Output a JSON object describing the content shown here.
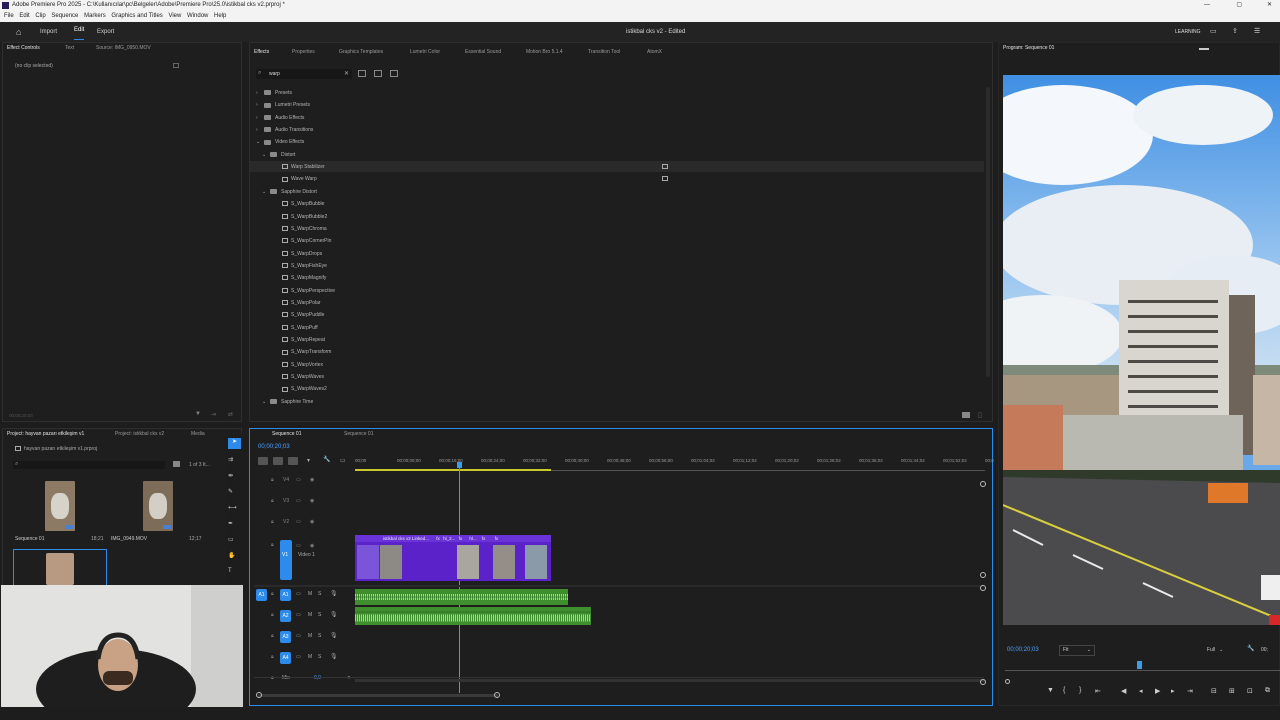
{
  "app": {
    "title": "Adobe Premiere Pro 2025 - C:\\Kullanıcılar\\pc\\Belgeler\\Adobe\\Premiere Pro\\25.0\\istikbal cks v2.prproj *",
    "menu": [
      "File",
      "Edit",
      "Clip",
      "Sequence",
      "Markers",
      "Graphics and Titles",
      "View",
      "Window",
      "Help"
    ],
    "workspaces": [
      "Import",
      "Edit",
      "Export"
    ],
    "project_title": "istikbal cks v2 - Edited",
    "learning": "LEARNING"
  },
  "source_panel": {
    "tabs": [
      "Effect Controls",
      "Text",
      "Source: IMG_0950.MOV"
    ],
    "no_clip": "(no clip selected)",
    "timecode": "00;00;20;03"
  },
  "effects_panel": {
    "tabs": [
      "Effects",
      "Properties",
      "Graphics Templates",
      "Lumetri Color",
      "Essential Sound",
      "Motion Bro 5.1.4",
      "Transition Tool",
      "AtomX"
    ],
    "search_value": "warp",
    "tree": [
      {
        "label": "Presets",
        "type": "folder",
        "level": 0,
        "open": false
      },
      {
        "label": "Lumetri Presets",
        "type": "folder",
        "level": 0,
        "open": false
      },
      {
        "label": "Audio Effects",
        "type": "folder",
        "level": 0,
        "open": false
      },
      {
        "label": "Audio Transitions",
        "type": "folder",
        "level": 0,
        "open": false
      },
      {
        "label": "Video Effects",
        "type": "folder",
        "level": 0,
        "open": true
      },
      {
        "label": "Distort",
        "type": "folder",
        "level": 1,
        "open": true
      },
      {
        "label": "Warp Stabilizer",
        "type": "effect",
        "level": 2,
        "selected": true,
        "accel": true
      },
      {
        "label": "Wave Warp",
        "type": "effect",
        "level": 2,
        "accel": true
      },
      {
        "label": "Sapphire Distort",
        "type": "folder",
        "level": 1,
        "open": true
      },
      {
        "label": "S_WarpBubble",
        "type": "effect",
        "level": 2
      },
      {
        "label": "S_WarpBubble2",
        "type": "effect",
        "level": 2
      },
      {
        "label": "S_WarpChroma",
        "type": "effect",
        "level": 2
      },
      {
        "label": "S_WarpCornerPin",
        "type": "effect",
        "level": 2
      },
      {
        "label": "S_WarpDrops",
        "type": "effect",
        "level": 2
      },
      {
        "label": "S_WarpFishEye",
        "type": "effect",
        "level": 2
      },
      {
        "label": "S_WarpMagnify",
        "type": "effect",
        "level": 2
      },
      {
        "label": "S_WarpPerspective",
        "type": "effect",
        "level": 2
      },
      {
        "label": "S_WarpPolar",
        "type": "effect",
        "level": 2
      },
      {
        "label": "S_WarpPuddle",
        "type": "effect",
        "level": 2
      },
      {
        "label": "S_WarpPuff",
        "type": "effect",
        "level": 2
      },
      {
        "label": "S_WarpRepeat",
        "type": "effect",
        "level": 2
      },
      {
        "label": "S_WarpTransform",
        "type": "effect",
        "level": 2
      },
      {
        "label": "S_WarpVortex",
        "type": "effect",
        "level": 2
      },
      {
        "label": "S_WarpWaves",
        "type": "effect",
        "level": 2
      },
      {
        "label": "S_WarpWaves2",
        "type": "effect",
        "level": 2
      },
      {
        "label": "Sapphire Time",
        "type": "folder",
        "level": 1,
        "open": true
      }
    ]
  },
  "program_monitor": {
    "tab": "Program: Sequence 01",
    "timecode": "00;00;20;03",
    "fit": "Fit",
    "quality": "Full",
    "end_timecode": "00;"
  },
  "project_panel": {
    "tabs": [
      "Project: hayvan pazarı etkileşim v1",
      "Project: istikbal cks v2",
      "Media"
    ],
    "path": "hayvan pazarı etkileşim v1.prproj",
    "count": "1 of 3 It...",
    "items": [
      {
        "name": "Sequence 01",
        "duration": "18;21"
      },
      {
        "name": "IMG_0949.MOV",
        "duration": "12;17"
      }
    ]
  },
  "timeline": {
    "tabs": [
      "Sequence 01",
      "Sequence 01"
    ],
    "timecode": "00;00;20;03",
    "ruler": [
      "00;00",
      "00;00;08;00",
      "00;00;16;00",
      "00;00;24;00",
      "00;00;32;00",
      "00;00;40;00",
      "00;00;48;00",
      "00;00;56;00",
      "00;01;04;02",
      "00;01;12;02",
      "00;01;20;02",
      "00;01;28;02",
      "00;01;36;02",
      "00;01;44;02",
      "00;01;52;02",
      "00;0"
    ],
    "video_tracks": [
      "V4",
      "V3",
      "V2",
      "V1"
    ],
    "v1_name": "Video 1",
    "audio_tracks": [
      "A1",
      "A2",
      "A3",
      "A4"
    ],
    "mix_label": "Mix",
    "mix_value": "0,0",
    "clip_labels": [
      "istikbal cks v2 Linked...",
      "fx",
      "hl_2...",
      "fx",
      "hl...",
      "fx",
      "fx"
    ]
  },
  "colors": {
    "accent": "#2d8ceb",
    "video_clip": "#5a22c8",
    "audio_clip": "#3f8f2f",
    "playhead": "#3a9fe6"
  }
}
